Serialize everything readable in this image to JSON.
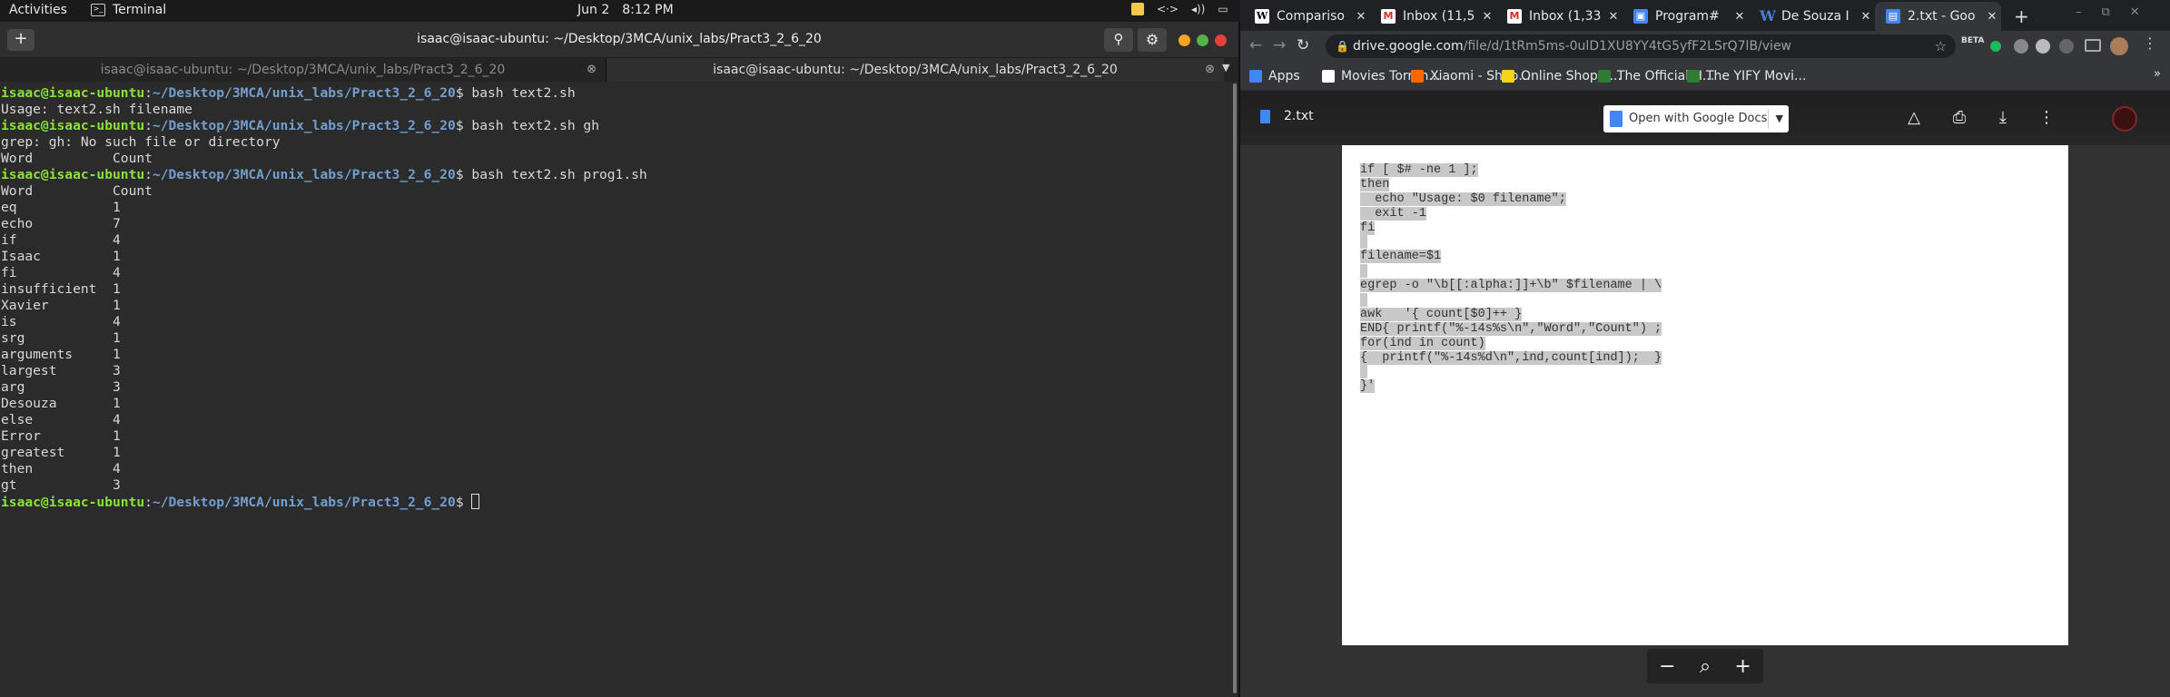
{
  "topbar": {
    "activities": "Activities",
    "app_name": "Terminal",
    "date": "Jun 2",
    "time": "8:12 PM",
    "tray_net": "<·>",
    "tray_vol": "◂))",
    "tray_power": "▭"
  },
  "terminal": {
    "title": "isaac@isaac-ubuntu: ~/Desktop/3MCA/unix_labs/Pract3_2_6_20",
    "tabs": [
      {
        "label": "isaac@isaac-ubuntu: ~/Desktop/3MCA/unix_labs/Pract3_2_6_20",
        "active": false
      },
      {
        "label": "isaac@isaac-ubuntu: ~/Desktop/3MCA/unix_labs/Pract3_2_6_20",
        "active": true
      }
    ],
    "prompt_user": "isaac@isaac-ubuntu",
    "prompt_path": "~/Desktop/3MCA/unix_labs/Pract3_2_6_20",
    "lines": [
      {
        "type": "cmd",
        "text": "bash text2.sh"
      },
      {
        "type": "out",
        "text": "Usage: text2.sh filename"
      },
      {
        "type": "cmd",
        "text": "bash text2.sh gh"
      },
      {
        "type": "out",
        "text": "grep: gh: No such file or directory"
      },
      {
        "type": "out",
        "text": "Word          Count"
      },
      {
        "type": "cmd",
        "text": "bash text2.sh prog1.sh"
      },
      {
        "type": "out",
        "text": "Word          Count"
      },
      {
        "type": "out",
        "text": "eq            1"
      },
      {
        "type": "out",
        "text": "echo          7"
      },
      {
        "type": "out",
        "text": "if            4"
      },
      {
        "type": "out",
        "text": "Isaac         1"
      },
      {
        "type": "out",
        "text": "fi            4"
      },
      {
        "type": "out",
        "text": "insufficient  1"
      },
      {
        "type": "out",
        "text": "Xavier        1"
      },
      {
        "type": "out",
        "text": "is            4"
      },
      {
        "type": "out",
        "text": "srg           1"
      },
      {
        "type": "out",
        "text": "arguments     1"
      },
      {
        "type": "out",
        "text": "largest       3"
      },
      {
        "type": "out",
        "text": "arg           3"
      },
      {
        "type": "out",
        "text": "Desouza       1"
      },
      {
        "type": "out",
        "text": "else          4"
      },
      {
        "type": "out",
        "text": "Error         1"
      },
      {
        "type": "out",
        "text": "greatest      1"
      },
      {
        "type": "out",
        "text": "then          4"
      },
      {
        "type": "out",
        "text": "gt            3"
      },
      {
        "type": "prompt",
        "text": ""
      }
    ]
  },
  "chrome": {
    "tabs": [
      {
        "label": "Compariso",
        "icon": "wikipedia-icon",
        "fav": "W",
        "cls": "wiki",
        "active": false
      },
      {
        "label": "Inbox (11,5",
        "icon": "gmail-icon",
        "fav": "M",
        "cls": "gmail",
        "active": false
      },
      {
        "label": "Inbox (1,33",
        "icon": "gmail-icon",
        "fav": "M",
        "cls": "gmail",
        "active": false
      },
      {
        "label": "Program#",
        "icon": "document-icon",
        "fav": "▣",
        "cls": "doc",
        "active": false
      },
      {
        "label": "De Souza I",
        "icon": "word-icon",
        "fav": "W",
        "cls": "word",
        "active": false
      },
      {
        "label": "2.txt - Goo",
        "icon": "docs-icon",
        "fav": "▤",
        "cls": "docb",
        "active": true
      }
    ],
    "omnibox": {
      "host": "drive.google.com",
      "path": "/file/d/1tRm5ms-0ulD1XU8YY4tG5yfF2LSrQ7lB/view"
    },
    "bookmarks": [
      {
        "label": "Apps",
        "color": "#4285f4"
      },
      {
        "label": "Movies Torren...",
        "color": "#ffffff"
      },
      {
        "label": "Xiaomi - Shop...",
        "color": "#ff6700"
      },
      {
        "label": "Online Shoppi...",
        "color": "#f7d417"
      },
      {
        "label": "The Official H...",
        "color": "#2e7d32"
      },
      {
        "label": "The YIFY Movi...",
        "color": "#2e7d32"
      }
    ],
    "bookmarks_more": "»",
    "beta_label": "BETA"
  },
  "viewer": {
    "filename": "2.txt",
    "open_with": "Open with Google Docs",
    "file_lines": [
      "if [ $# -ne 1 ];",
      "then",
      "  echo \"Usage: $0 filename\";",
      "  exit -1",
      "fi",
      "",
      "filename=$1",
      "",
      "egrep -o \"\\b[[:alpha:]]+\\b\" $filename | \\",
      "",
      "awk   '{ count[$0]++ }",
      "END{ printf(\"%-14s%s\\n\",\"Word\",\"Count\") ;",
      "for(ind in count)",
      "{  printf(\"%-14s%d\\n\",ind,count[ind]);  }",
      "",
      "}'"
    ],
    "zoom_out": "−",
    "zoom_fit": "⌕",
    "zoom_in": "+"
  },
  "colors": {
    "prompt_user": "#8ae234",
    "prompt_path": "#729fcf",
    "terminal_bg": "#2b2b2b",
    "chrome_bg": "#202124"
  }
}
